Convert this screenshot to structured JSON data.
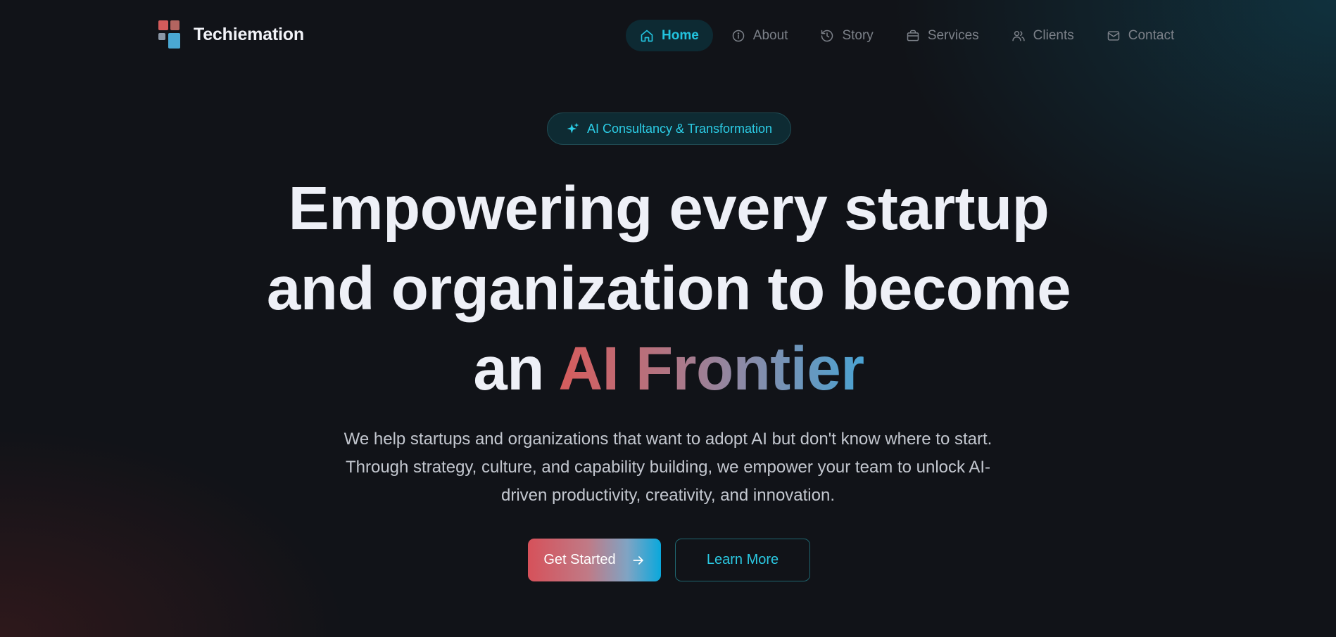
{
  "brand": {
    "name": "Techiemation",
    "logo_icon": "logo-blocks-icon"
  },
  "nav": {
    "items": [
      {
        "label": "Home",
        "icon": "home-icon",
        "active": true
      },
      {
        "label": "About",
        "icon": "info-icon",
        "active": false
      },
      {
        "label": "Story",
        "icon": "history-icon",
        "active": false
      },
      {
        "label": "Services",
        "icon": "briefcase-icon",
        "active": false
      },
      {
        "label": "Clients",
        "icon": "users-icon",
        "active": false
      },
      {
        "label": "Contact",
        "icon": "mail-icon",
        "active": false
      }
    ]
  },
  "hero": {
    "badge": {
      "text": "AI Consultancy & Transformation",
      "icon": "sparkles-icon"
    },
    "headline": {
      "line1": "Empowering every startup",
      "line2": "and organization to become",
      "line3_prefix": "an",
      "highlight": "AI Frontier"
    },
    "description": "We help startups and organizations that want to adopt AI but don't know where to start. Through strategy, culture, and capability building, we empower your team to unlock AI-driven productivity, creativity, and innovation.",
    "primary_cta": {
      "label": "Get Started",
      "icon": "arrow-right-icon"
    },
    "secondary_cta": {
      "label": "Learn More"
    }
  },
  "colors": {
    "background": "#111318",
    "accent": "#22c3de",
    "gradient_start": "#d65c5c",
    "gradient_end": "#4aa3d3",
    "nav_muted": "#7c8189"
  }
}
